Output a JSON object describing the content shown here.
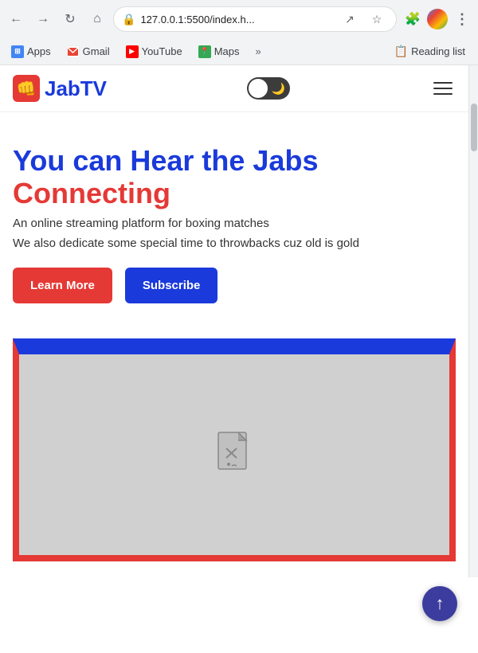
{
  "browser": {
    "url": "127.0.0.1:5500/index.h...",
    "back_btn": "←",
    "forward_btn": "→",
    "reload_btn": "↻",
    "home_btn": "⌂",
    "more_btn": "⋮",
    "share_btn": "↗",
    "star_btn": "☆",
    "extension_btn": "🧩",
    "bookmarks": [
      {
        "label": "Apps",
        "color": "#4285f4"
      },
      {
        "label": "Gmail",
        "color": "#ea4335"
      },
      {
        "label": "YouTube",
        "color": "#ff0000"
      },
      {
        "label": "Maps",
        "color": "#34a853"
      }
    ],
    "reading_list": "Reading list",
    "more_bookmarks": "»"
  },
  "site": {
    "logo_text": "JabTV",
    "logo_emoji": "👊",
    "hero_title_line1": "You can Hear the Jabs",
    "hero_title_line2": "Connecting",
    "hero_subtitle1": "An online streaming platform for boxing matches",
    "hero_subtitle2": "We also dedicate some special time to throwbacks cuz old is gold",
    "btn_learn_more": "Learn More",
    "btn_subscribe": "Subscribe",
    "toggle_moon": "🌙",
    "fab_icon": "↑"
  }
}
